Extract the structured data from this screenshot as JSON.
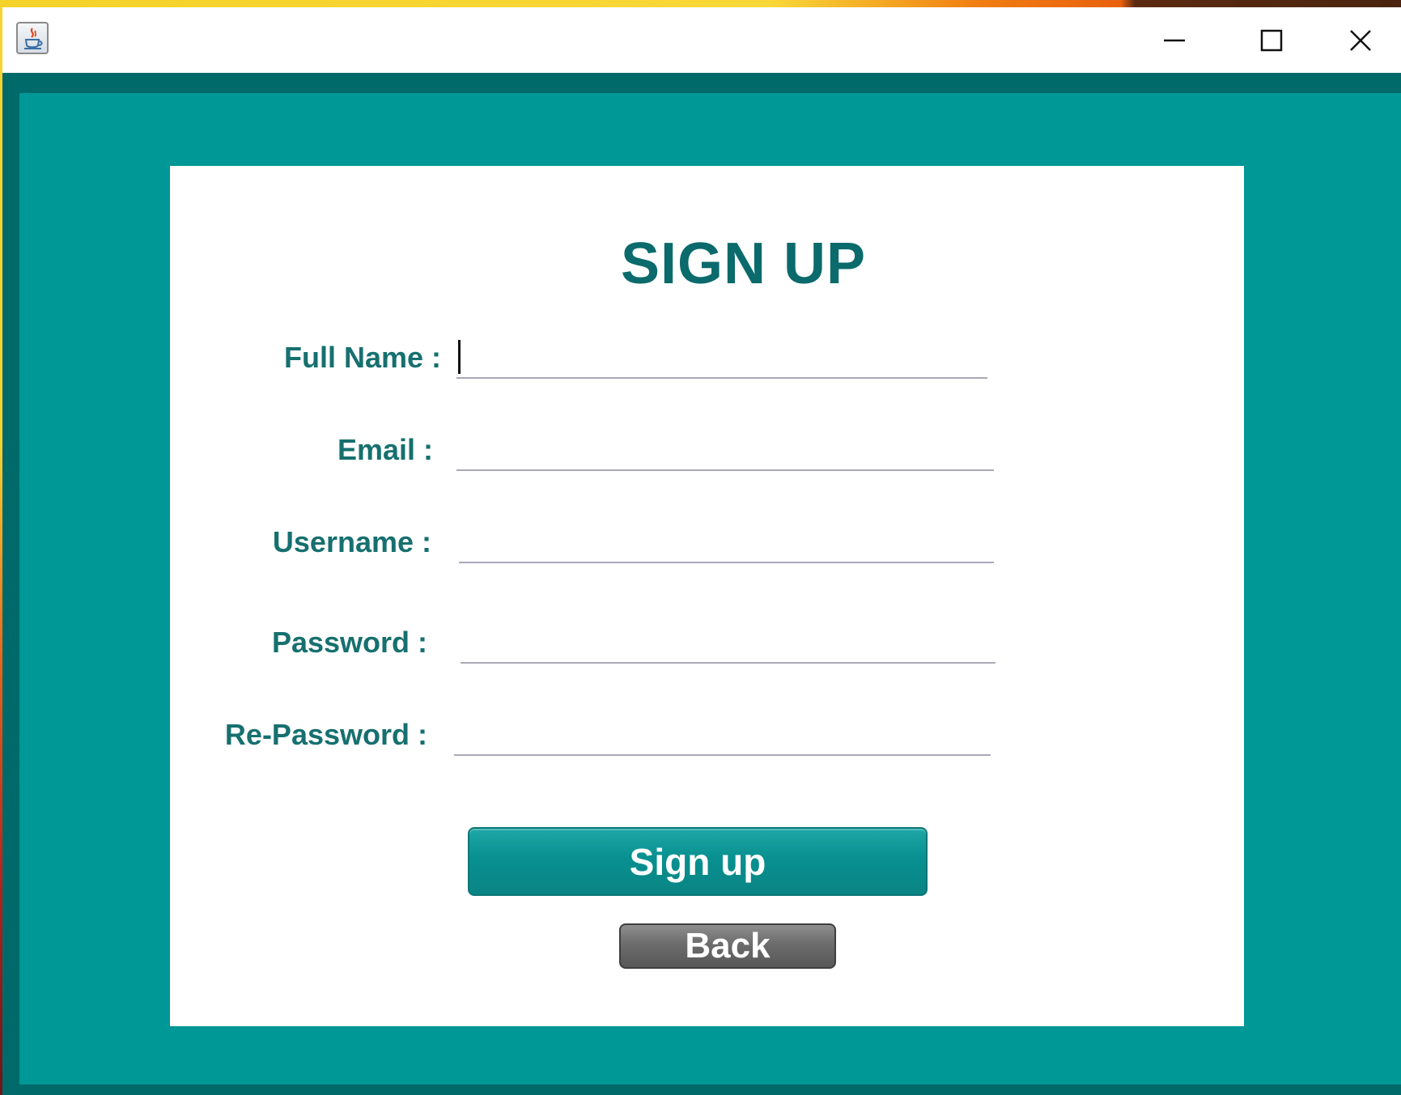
{
  "window": {
    "app_icon": "java-coffee-cup-icon",
    "controls": {
      "minimize_icon": "minimize-icon",
      "maximize_icon": "maximize-icon",
      "close_icon": "close-icon"
    }
  },
  "form": {
    "title": "SIGN UP",
    "fields": {
      "full_name": {
        "label": "Full Name :",
        "value": ""
      },
      "email": {
        "label": "Email :",
        "value": ""
      },
      "username": {
        "label": "Username :",
        "value": ""
      },
      "password": {
        "label": "Password :",
        "value": ""
      },
      "re_password": {
        "label": "Re-Password :",
        "value": ""
      }
    },
    "signup_button": "Sign up",
    "back_button": "Back"
  },
  "colors": {
    "frame_dark_teal": "#00696a",
    "panel_teal": "#009797",
    "label_teal": "#16706f",
    "title_teal": "#0b6a6c",
    "back_button_gray": "#6c6c6c"
  }
}
